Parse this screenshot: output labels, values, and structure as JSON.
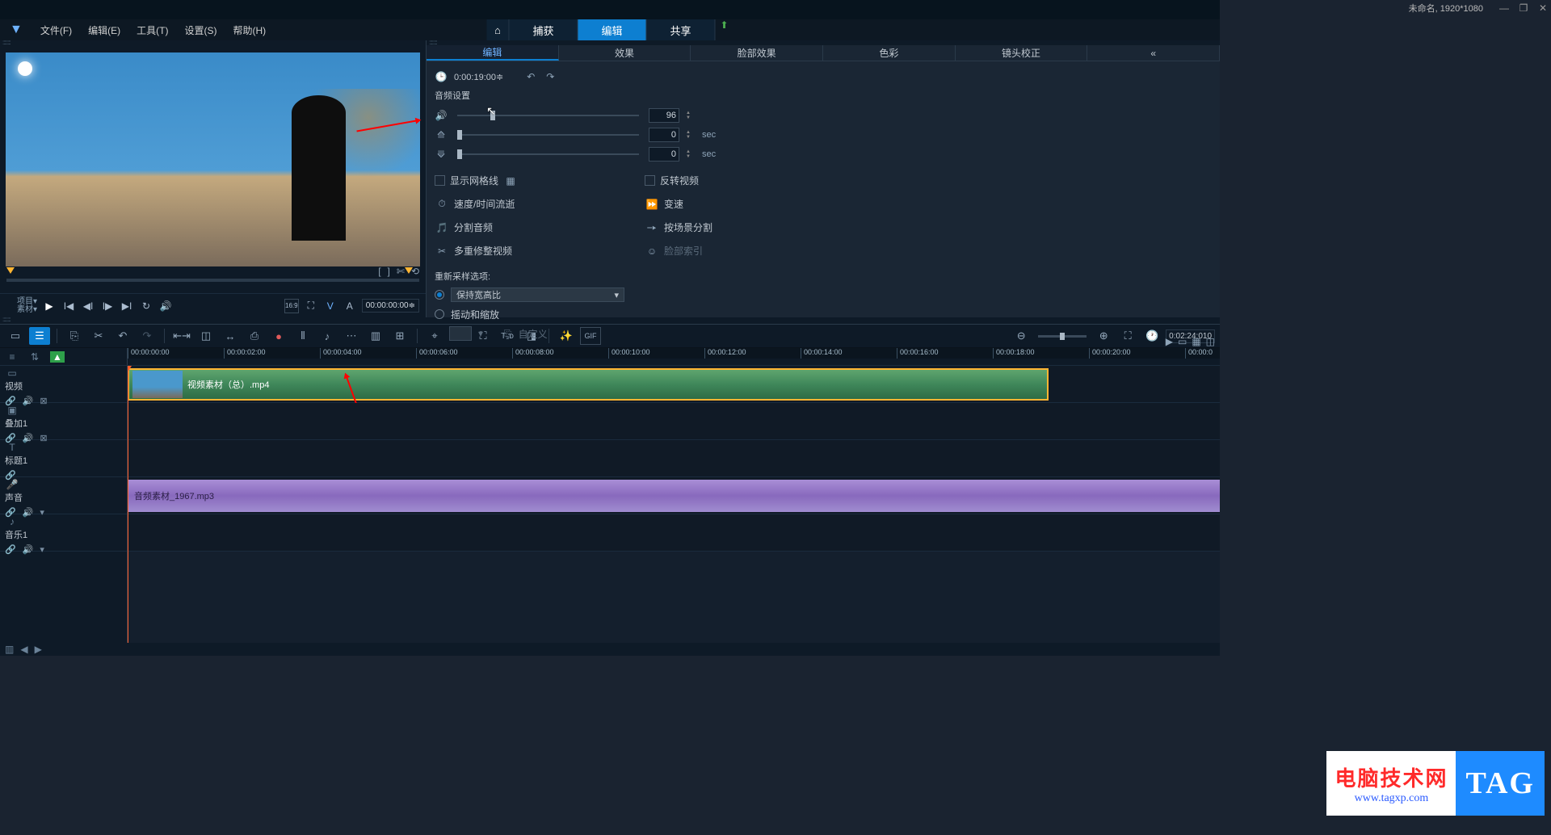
{
  "title_bar": {
    "project_info": "未命名, 1920*1080"
  },
  "menu": {
    "file": "文件(F)",
    "edit": "编辑(E)",
    "tools": "工具(T)",
    "settings": "设置(S)",
    "help": "帮助(H)"
  },
  "mode_tabs": {
    "capture": "捕获",
    "edit": "编辑",
    "share": "共享"
  },
  "preview": {
    "proj_label": "项目▾\n素材▾",
    "timecode": "00:00:00:00≑",
    "scrub_icons": {
      "mark_in": "[",
      "mark_out": "]",
      "scissor": "✄",
      "prev": "⟲"
    }
  },
  "options": {
    "tabs": {
      "edit": "编辑",
      "effect": "效果",
      "face": "脸部效果",
      "color": "色彩",
      "lens": "镜头校正"
    },
    "timecode": "0:00:19:00≑",
    "section": "音频设置",
    "volume_value": "96",
    "fadein_value": "0",
    "fadeout_value": "0",
    "sec": "sec",
    "show_grid": "显示网格线",
    "reverse_video": "反转视频",
    "speed_time": "速度/时间流逝",
    "var_speed": "变速",
    "split_audio": "分割音频",
    "scene_split": "按场景分割",
    "multi_trim": "多重修整视频",
    "face_index": "脸部索引",
    "resample_label": "重新采样选项:",
    "resample_val": "保持宽高比",
    "pan_zoom": "摇动和缩放",
    "custom": "自定义"
  },
  "zoom": {
    "timecode": "0:02:24:010"
  },
  "tracks": {
    "video": "视频",
    "overlay": "叠加1",
    "title": "标题1",
    "voice": "声音",
    "music": "音乐1",
    "clip_video": "视频素材（总）.mp4",
    "clip_audio": "音频素材_1967.mp3"
  },
  "ruler": [
    "00:00:00:00",
    "00:00:02:00",
    "00:00:04:00",
    "00:00:06:00",
    "00:00:08:00",
    "00:00:10:00",
    "00:00:12:00",
    "00:00:14:00",
    "00:00:16:00",
    "00:00:18:00",
    "00:00:20:00",
    "00:00:0"
  ],
  "watermark": {
    "cn": "电脑技术网",
    "url": "www.tagxp.com",
    "tag": "TAG"
  }
}
